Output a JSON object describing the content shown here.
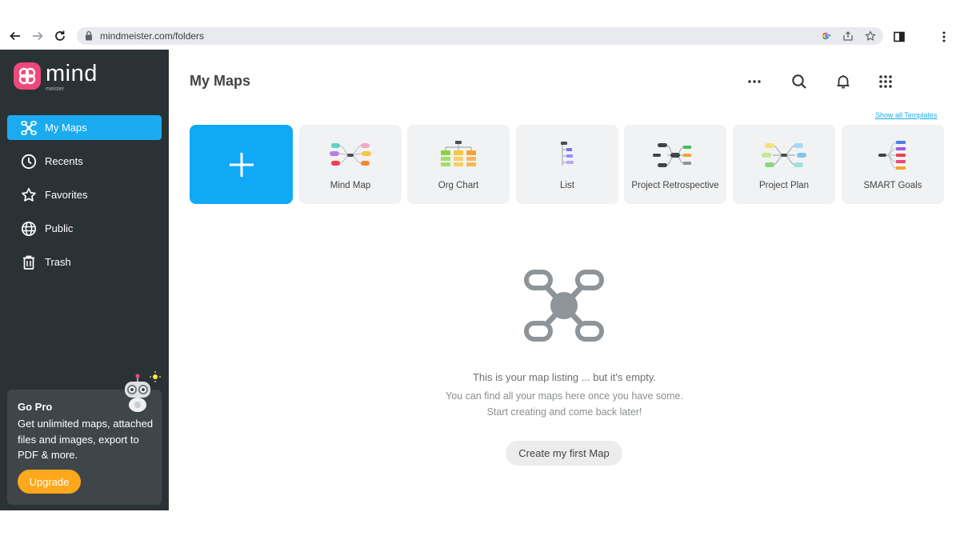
{
  "browser": {
    "url": "mindmeister.com/folders",
    "icons": [
      "back-icon",
      "forward-icon",
      "reload-icon",
      "lock-icon",
      "google-icon",
      "share-icon",
      "star-icon",
      "sidepanel-icon",
      "menu-icon"
    ]
  },
  "logo": {
    "word": "mind",
    "sub": "meister"
  },
  "sidebar": {
    "items": [
      {
        "label": "My Maps",
        "icon": "mindmap-icon",
        "active": true
      },
      {
        "label": "Recents",
        "icon": "clock-icon"
      },
      {
        "label": "Favorites",
        "icon": "star-icon"
      },
      {
        "label": "Public",
        "icon": "globe-icon"
      },
      {
        "label": "Trash",
        "icon": "trash-icon"
      }
    ],
    "gopro": {
      "title": "Go Pro",
      "text": "Get unlimited maps, attached files and images, export to PDF & more.",
      "button": "Upgrade"
    }
  },
  "main": {
    "title": "My Maps",
    "show_templates": "Show all Templates",
    "templates": [
      {
        "label": "Mind Map"
      },
      {
        "label": "Org Chart"
      },
      {
        "label": "List"
      },
      {
        "label": "Project Retrospective"
      },
      {
        "label": "Project Plan"
      },
      {
        "label": "SMART Goals"
      }
    ],
    "empty": {
      "line1": "This is your map listing ... but it's empty.",
      "line2": "You can find all your maps here once you have some.",
      "line3": "Start creating and come back later!",
      "button": "Create my first Map"
    }
  },
  "colors": {
    "sidebar_bg": "#2b3236",
    "accent": "#1aabf0",
    "upgrade": "#ffa81c",
    "logo_pink": "#f0487a"
  }
}
